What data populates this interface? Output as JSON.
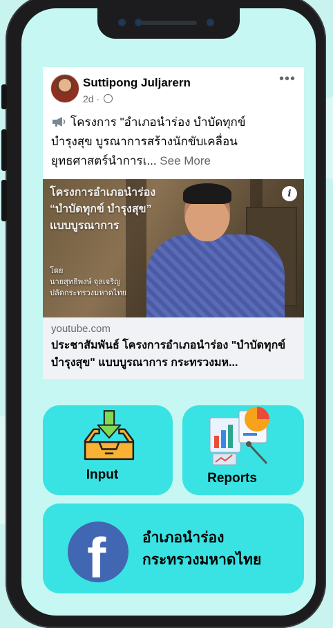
{
  "post": {
    "author": "Suttipong Juljarern",
    "time": "2d",
    "menu_icon": "more-options-icon",
    "text_line1": "โครงการ \"อำเภอนำร่อง บำบัดทุกข์",
    "text_line2": "บำรุงสุข บูรณาการสร้างนักขับเคลื่อน",
    "text_line3": "ยุทธศาสตร์นำการเ...",
    "see_more": "See More",
    "thumbnail": {
      "title_line1": "โครงการอำเภอนำร่อง",
      "title_line2": "“บำบัดทุกข์ บำรุงสุข”",
      "title_line3": "แบบบูรณาการ",
      "credit_line1": "โดย",
      "credit_line2": "นายสุทธิพงษ์ จุลเจริญ",
      "credit_line3": "ปลัดกระทรวงมหาดไทย",
      "info_icon": "i"
    },
    "link": {
      "domain": "youtube.com",
      "title": "ประชาสัมพันธ์ โครงการอำเภอนำร่อง \"บำบัดทุกข์ บำรุงสุข\" แบบบูรณาการ กระทรวงมห..."
    }
  },
  "tiles": {
    "input_label": "Input",
    "reports_label": "Reports",
    "facebook_line1": "อำเภอนำร่อง",
    "facebook_line2": "กระทรวงมหาดไทย"
  },
  "colors": {
    "background": "#c6f7f2",
    "tile": "#3ae3e3",
    "facebook": "#4267b2"
  }
}
